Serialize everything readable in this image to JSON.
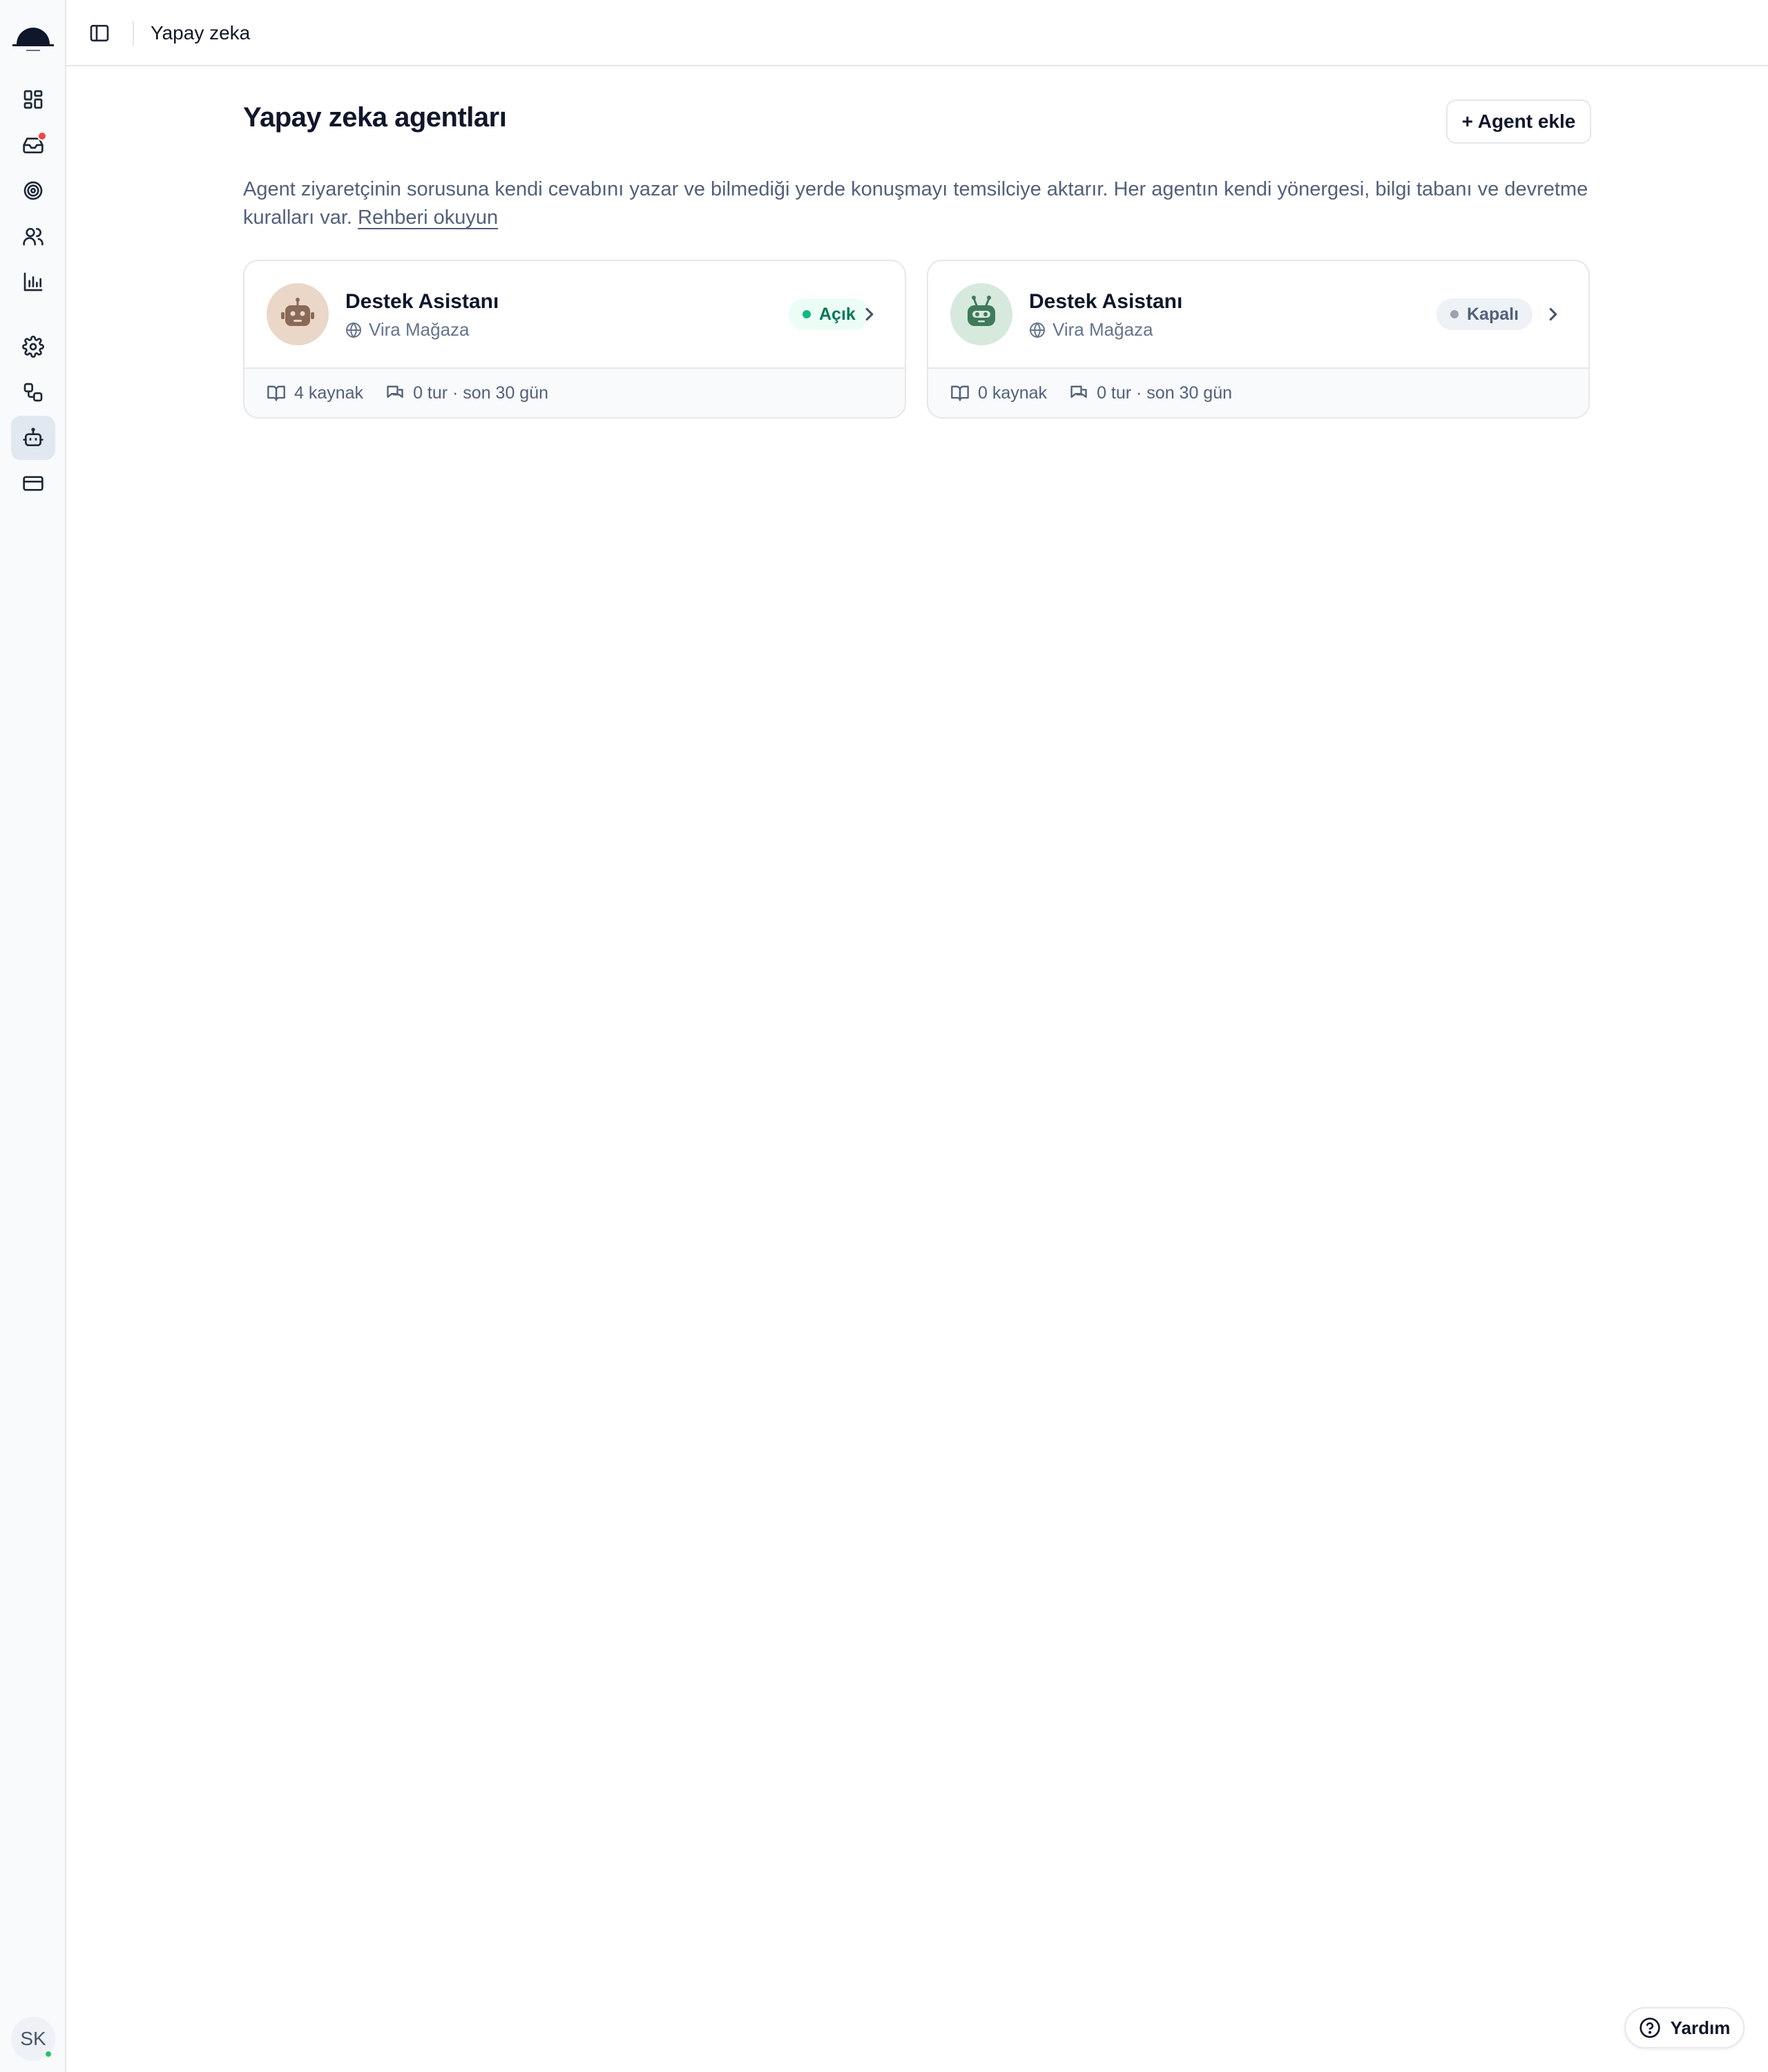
{
  "header": {
    "breadcrumb": "Yapay zeka"
  },
  "page": {
    "title": "Yapay zeka agentları",
    "add_button": "+ Agent ekle",
    "description": "Agent ziyaretçinin sorusuna kendi cevabını yazar ve bilmediği yerde konuşmayı temsilciye aktarır. Her agentın kendi yönergesi, bilgi tabanı ve devretme kuralları var.",
    "guide_link": "Rehberi okuyun"
  },
  "sidebar": {
    "items": [
      {
        "icon": "dashboard-icon"
      },
      {
        "icon": "inbox-icon",
        "has_notification": true
      },
      {
        "icon": "target-icon"
      },
      {
        "icon": "users-icon"
      },
      {
        "icon": "chart-icon"
      },
      {
        "icon": "gear-icon"
      },
      {
        "icon": "integrations-icon"
      },
      {
        "icon": "bot-icon",
        "active": true
      },
      {
        "icon": "credit-card-icon"
      }
    ],
    "user_initials": "SK"
  },
  "agents": [
    {
      "name": "Destek Asistanı",
      "site": "Vira Mağaza",
      "status": "Açık",
      "sources": "4 kaynak",
      "turns": "0 tur · son 30 gün",
      "avatar_bg": "#ead7c8",
      "avatar_color": "#8a6a57"
    },
    {
      "name": "Destek Asistanı",
      "site": "Vira Mağaza",
      "status": "Kapalı",
      "sources": "0 kaynak",
      "turns": "0 tur · son 30 gün",
      "avatar_bg": "#d6e9dc",
      "avatar_color": "#3f7a5a"
    }
  ],
  "help": {
    "label": "Yardım"
  },
  "colors": {
    "status_on": "#047857",
    "status_on_bg": "#ecfdf5",
    "notification": "#ef4444"
  }
}
